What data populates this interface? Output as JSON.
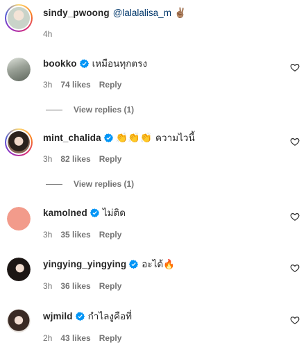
{
  "comments": [
    {
      "username": "sindy_pwoong",
      "mention": "@lalalalisa_m",
      "emoji": "✌🏽",
      "time": "4h"
    },
    {
      "username": "bookko",
      "text": "เหมือนทุกตรง",
      "time": "3h",
      "likes": "74 likes",
      "reply": "Reply",
      "view_replies": "View replies (1)"
    },
    {
      "username": "mint_chalida",
      "emoji": "👏👏👏",
      "text": "ความไวนี้",
      "time": "3h",
      "likes": "82 likes",
      "reply": "Reply",
      "view_replies": "View replies (1)"
    },
    {
      "username": "kamolned",
      "text": "ไม่ติด",
      "time": "3h",
      "likes": "35 likes",
      "reply": "Reply"
    },
    {
      "username": "yingying_yingying",
      "text": "อะไต้🔥",
      "time": "3h",
      "likes": "36 likes",
      "reply": "Reply"
    },
    {
      "username": "wjmild",
      "text": "กำไลงูคือที่",
      "time": "2h",
      "likes": "43 likes",
      "reply": "Reply"
    }
  ],
  "colors": {
    "verified_blue": "#0095f6",
    "meta_gray": "#737373",
    "mention_blue": "#00376b",
    "kamolned_avatar": "#f29b8b"
  }
}
